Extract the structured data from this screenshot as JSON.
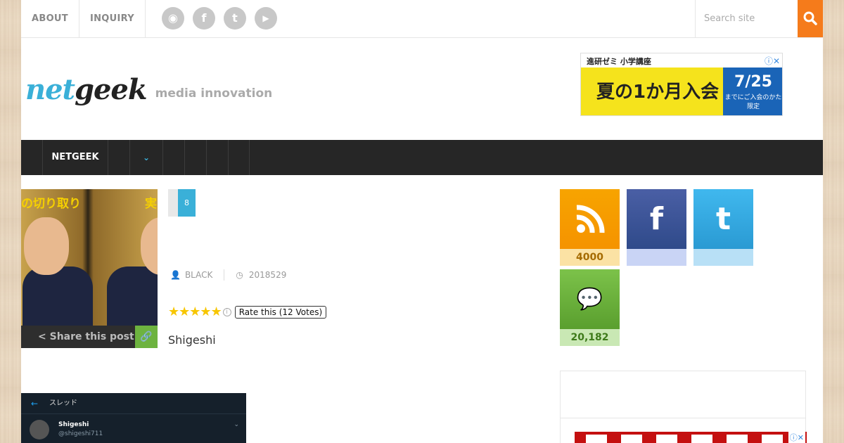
{
  "topnav": {
    "items": [
      "ABOUT",
      "INQUIRY"
    ]
  },
  "social": [
    {
      "icon": "rss-icon",
      "glyph": "◉"
    },
    {
      "icon": "facebook-icon",
      "glyph": "f"
    },
    {
      "icon": "twitter-icon",
      "glyph": "t"
    },
    {
      "icon": "youtube-icon",
      "glyph": "▶"
    }
  ],
  "search": {
    "placeholder": "Search site"
  },
  "logo": {
    "part1": "net",
    "part2": "geek",
    "tagline": "media innovation"
  },
  "ad": {
    "top": "進研ゼミ 小学講座",
    "main": "夏の1か月入会",
    "date": "7/25",
    "date_note": "までにご入会のかた限定"
  },
  "navbar": {
    "items": [
      "NETGEEK"
    ]
  },
  "article": {
    "comment_count": "8",
    "author": "BLACK",
    "date": "2018529",
    "rating_tip": "Rate this (12 Votes)",
    "byline": "Shigeshi",
    "share_label": "Share this post",
    "thumb_caption_left": "の切り取り",
    "thumb_caption_right": "実"
  },
  "tweet": {
    "header": "スレッド",
    "name": "Shigeshi",
    "handle": "@shigeshi711"
  },
  "sidebar": {
    "rss_count": "4000",
    "facebook_count": "",
    "twitter_count": "",
    "comments_count": "20,182"
  },
  "colors": {
    "accent": "#3ab0d8",
    "search_button": "#f57b1b",
    "rss": "#f5a300",
    "facebook": "#3b5998",
    "twitter": "#2fa6df",
    "comments": "#67b23c"
  }
}
